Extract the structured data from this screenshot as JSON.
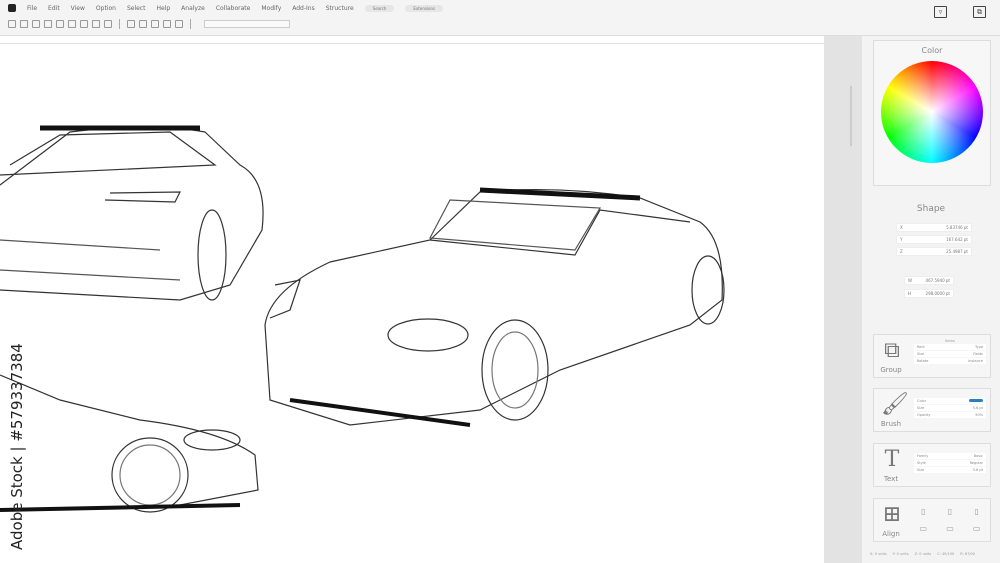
{
  "menu": [
    "File",
    "Edit",
    "View",
    "Option",
    "Select",
    "Help",
    "Analyze",
    "Collaborate",
    "Modify",
    "Add-Ins",
    "Structure"
  ],
  "menu_pills": [
    "Search",
    "Extensions"
  ],
  "panel": {
    "color_title": "Color",
    "shape_title": "Shape",
    "shape_fields": [
      {
        "k": "X",
        "v": "5.83746 pt"
      },
      {
        "k": "Y",
        "v": "167.642 pt"
      },
      {
        "k": "Z",
        "v": "25.4987 pt"
      }
    ],
    "size_fields": [
      {
        "k": "W",
        "v": "467.5940 pt"
      },
      {
        "k": "H",
        "v": "298.0000 pt"
      }
    ],
    "group": {
      "label": "Group",
      "header": "Items",
      "cells": [
        "Rect",
        "Type",
        "Size",
        "Fields",
        "Rotate",
        "Instance"
      ]
    },
    "brush": {
      "label": "Brush",
      "rows": [
        [
          "Color",
          ""
        ],
        [
          "Size",
          "5.6 pt"
        ],
        [
          "Opacity",
          "50%"
        ]
      ],
      "swatch": "#2a7fc1"
    },
    "text": {
      "label": "Text",
      "glyph": "T",
      "rows": [
        [
          "Family",
          "Basic"
        ],
        [
          "Style",
          "Regular"
        ],
        [
          "Size",
          "5.6 pt"
        ]
      ]
    },
    "align": {
      "label": "Align"
    }
  },
  "status": [
    "X: 0 units",
    "Y: 0 units",
    "Z: 0 units",
    "C: 49/100",
    "R: 67/00"
  ],
  "watermark": "Adobe Stock | #579337384"
}
